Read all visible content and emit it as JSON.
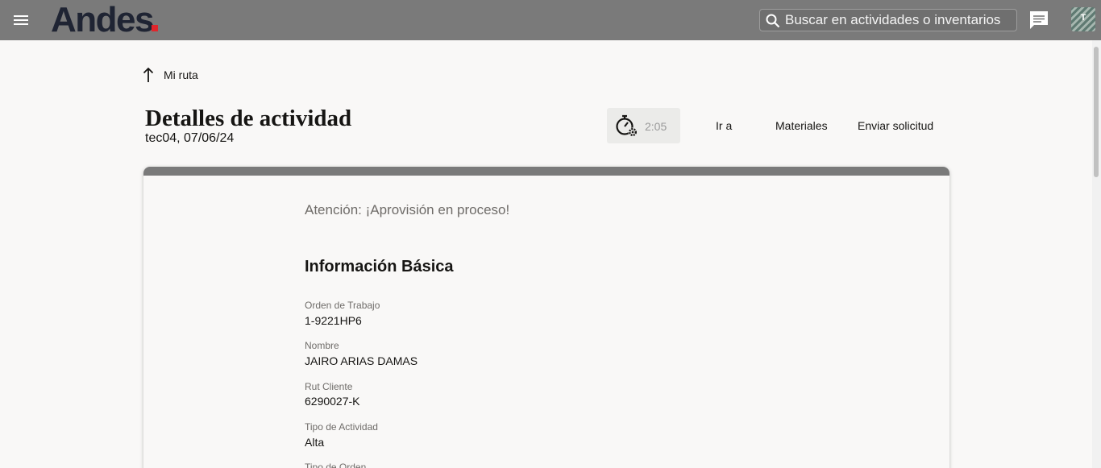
{
  "header": {
    "logo_text": "Andes",
    "search_placeholder": "Buscar en actividades o inventarios",
    "avatar_initial": "T"
  },
  "nav": {
    "back_label": "Mi ruta"
  },
  "page": {
    "title": "Detalles de actividad",
    "subtitle": "tec04, 07/06/24"
  },
  "toolbar": {
    "timer_value": "2:05",
    "goto_label": "Ir a",
    "materials_label": "Materiales",
    "send_request_label": "Enviar solicitud"
  },
  "card": {
    "alert": "Atención: ¡Aprovisión en proceso!",
    "section_title": "Información Básica",
    "fields": [
      {
        "label": "Orden de Trabajo",
        "value": "1-9221HP6"
      },
      {
        "label": "Nombre",
        "value": "JAIRO ARIAS DAMAS"
      },
      {
        "label": "Rut Cliente",
        "value": "6290027-K"
      },
      {
        "label": "Tipo de Actividad",
        "value": "Alta"
      },
      {
        "label": "Tipo de Orden",
        "value": ""
      }
    ]
  },
  "colors": {
    "header_bg": "#7a7a7a",
    "logo_dot": "#e0262b",
    "logo_text": "#1f2433"
  }
}
